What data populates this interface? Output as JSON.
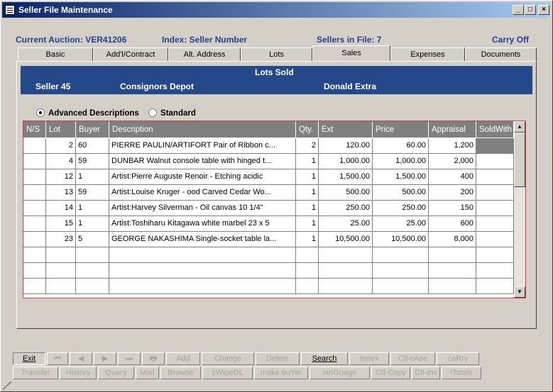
{
  "window": {
    "title": "Seller File Maintenance",
    "controls": {
      "minimize": "_",
      "maximize": "□",
      "close": "×"
    }
  },
  "info": {
    "auction": "Current Auction: VER41206",
    "index": "Index: Seller Number",
    "sellers": "Sellers in File: 7",
    "carry": "Carry Off"
  },
  "tabs": [
    "Basic",
    "Add'l/Contract",
    "Alt. Address",
    "Lots",
    "Sales",
    "Expenses",
    "Documents"
  ],
  "active_tab": "Sales",
  "header": {
    "title": "Lots Sold",
    "seller": "Seller 45",
    "company": "Consignors Depot",
    "name": "Donald Extra"
  },
  "options": {
    "advanced": "Advanced Descriptions",
    "standard": "Standard",
    "selected": "advanced"
  },
  "grid": {
    "columns": [
      "N/S",
      "Lot",
      "Buyer",
      "Description",
      "Qty.",
      "Ext",
      "Price",
      "Appraisal",
      "SoldWith"
    ],
    "rows": [
      {
        "ns": "",
        "lot": "2",
        "buyer": "60",
        "desc": "PIERRE PAULIN/ARTIFORT Pair of Ribbon c...",
        "qty": "2",
        "ext": "120.00",
        "price": "60.00",
        "appraisal": "1,200",
        "soldwith": ""
      },
      {
        "ns": "",
        "lot": "4",
        "buyer": "59",
        "desc": "DUNBAR Walnut console table with hinged t...",
        "qty": "1",
        "ext": "1,000.00",
        "price": "1,000.00",
        "appraisal": "2,000",
        "soldwith": ""
      },
      {
        "ns": "",
        "lot": "12",
        "buyer": "1",
        "desc": "Artist:Pierre Auguste Renoir - Etching acidic",
        "qty": "1",
        "ext": "1,500.00",
        "price": "1,500.00",
        "appraisal": "400",
        "soldwith": ""
      },
      {
        "ns": "",
        "lot": "13",
        "buyer": "59",
        "desc": "Artist:Louise Kruger - ood Carved Cedar Wo...",
        "qty": "1",
        "ext": "500.00",
        "price": "500.00",
        "appraisal": "200",
        "soldwith": ""
      },
      {
        "ns": "",
        "lot": "14",
        "buyer": "1",
        "desc": "Artist:Harvey Silverman - Oil canvas 10 1/4\"",
        "qty": "1",
        "ext": "250.00",
        "price": "250.00",
        "appraisal": "150",
        "soldwith": ""
      },
      {
        "ns": "",
        "lot": "15",
        "buyer": "1",
        "desc": "Artist:Toshiharu Kitagawa white marbel 23 x 5",
        "qty": "1",
        "ext": "25.00",
        "price": "25.00",
        "appraisal": "600",
        "soldwith": ""
      },
      {
        "ns": "",
        "lot": "23",
        "buyer": "5",
        "desc": "GEORGE NAKASHIMA Single-socket table la...",
        "qty": "1",
        "ext": "10,500.00",
        "price": "10,500.00",
        "appraisal": "8,000",
        "soldwith": ""
      }
    ],
    "empty_rows": 3,
    "scroll_up": "▲",
    "scroll_down": "▼"
  },
  "buttons_row1": [
    {
      "label": "Exit",
      "enabled": true,
      "pressed": true
    },
    {
      "label": "⏮",
      "enabled": false
    },
    {
      "label": "◀",
      "enabled": false
    },
    {
      "label": "▶",
      "enabled": false
    },
    {
      "label": "⏭",
      "enabled": false
    },
    {
      "label": "🖶",
      "enabled": false
    },
    {
      "label": "Add",
      "enabled": false
    },
    {
      "label": "Change",
      "enabled": false
    },
    {
      "label": "Delete",
      "enabled": false
    },
    {
      "label": "Search",
      "enabled": true
    },
    {
      "label": "Index",
      "enabled": false
    },
    {
      "label": "Ctl-cAse",
      "enabled": false
    },
    {
      "label": "caRry",
      "enabled": false
    }
  ],
  "buttons_row2": [
    {
      "label": "Transfer",
      "enabled": false
    },
    {
      "label": "History",
      "enabled": false
    },
    {
      "label": "Query",
      "enabled": false
    },
    {
      "label": "Mail",
      "enabled": false
    },
    {
      "label": "Browse",
      "enabled": false
    },
    {
      "label": "sWipeDL",
      "enabled": false
    },
    {
      "label": "make buYer",
      "enabled": false
    },
    {
      "label": "lanGuage",
      "enabled": false
    },
    {
      "label": "Ctl-Copy",
      "enabled": false
    },
    {
      "label": "Ctl-Inv",
      "enabled": false
    },
    {
      "label": "!Totals",
      "enabled": false
    }
  ]
}
